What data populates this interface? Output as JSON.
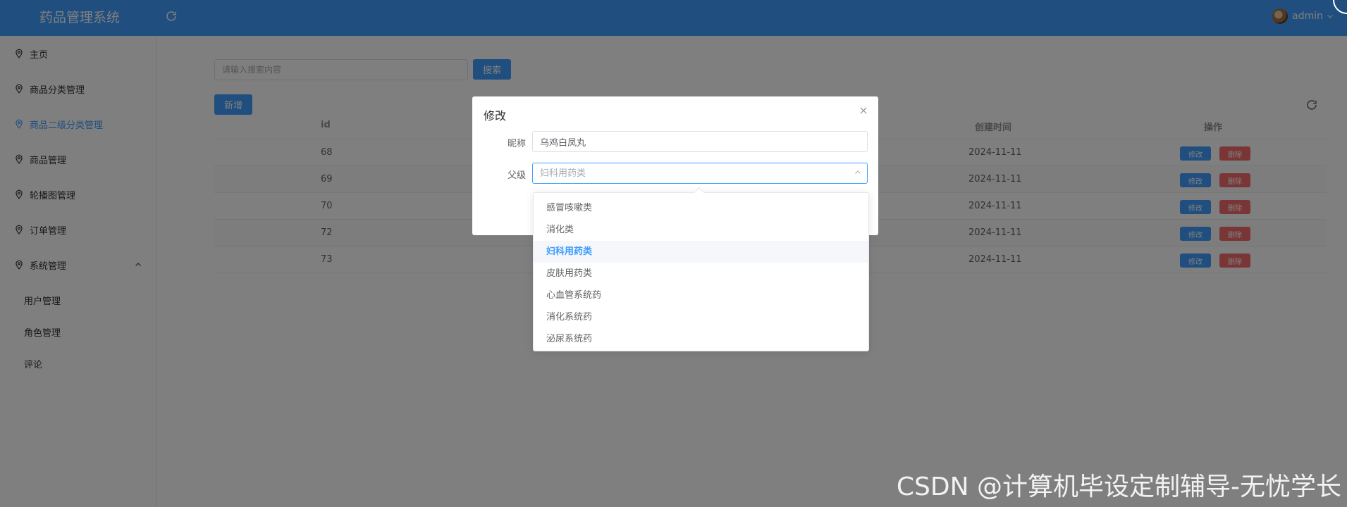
{
  "header": {
    "title": "药品管理系统",
    "user": "admin"
  },
  "sidebar": {
    "items": [
      {
        "label": "主页"
      },
      {
        "label": "商品分类管理"
      },
      {
        "label": "商品二级分类管理"
      },
      {
        "label": "商品管理"
      },
      {
        "label": "轮播图管理"
      },
      {
        "label": "订单管理"
      },
      {
        "label": "系统管理"
      }
    ],
    "sub_items": [
      {
        "label": "用户管理"
      },
      {
        "label": "角色管理"
      },
      {
        "label": "评论"
      }
    ]
  },
  "toolbar": {
    "search_placeholder": "请输入搜索内容",
    "search_label": "搜索",
    "add_label": "新增"
  },
  "table": {
    "columns": {
      "id": "id",
      "created": "创建时间",
      "actions": "操作"
    },
    "rows": [
      {
        "id": "68",
        "created": "2024-11-11"
      },
      {
        "id": "69",
        "created": "2024-11-11"
      },
      {
        "id": "70",
        "created": "2024-11-11"
      },
      {
        "id": "72",
        "created": "2024-11-11"
      },
      {
        "id": "73",
        "created": "2024-11-11"
      }
    ],
    "edit_label": "修改",
    "delete_label": "删除"
  },
  "dialog": {
    "title": "修改",
    "name_label": "昵称",
    "name_value": "乌鸡白凤丸",
    "parent_label": "父级",
    "parent_placeholder": "妇科用药类"
  },
  "dropdown": {
    "options": [
      "感冒咳嗽类",
      "消化类",
      "妇科用药类",
      "皮肤用药类",
      "心血管系统药",
      "消化系统药",
      "泌尿系统药"
    ],
    "selected": "妇科用药类"
  },
  "watermark": "CSDN @计算机毕设定制辅导-无忧学长",
  "colors": {
    "primary": "#409eff",
    "danger": "#f56c6c"
  }
}
